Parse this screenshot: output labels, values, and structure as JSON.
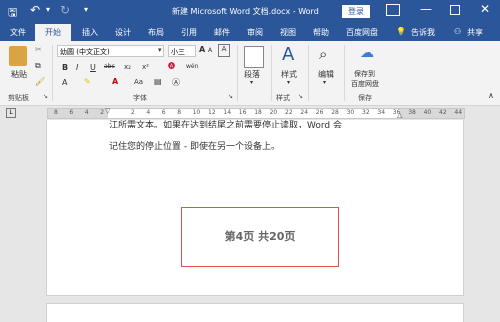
{
  "titlebar": {
    "title": "新建 Microsoft Word 文档.docx  -  Word",
    "login": "登录",
    "save_icon": "save-icon",
    "undo_icon": "undo-icon",
    "redo_icon": "redo-icon",
    "colors": {
      "bg": "#2b579a"
    }
  },
  "tabs": [
    {
      "label": "文件"
    },
    {
      "label": "开始"
    },
    {
      "label": "插入"
    },
    {
      "label": "设计"
    },
    {
      "label": "布局"
    },
    {
      "label": "引用"
    },
    {
      "label": "邮件"
    },
    {
      "label": "审阅"
    },
    {
      "label": "视图"
    },
    {
      "label": "帮助"
    },
    {
      "label": "百度网盘"
    },
    {
      "label": "告诉我"
    },
    {
      "label": "共享"
    }
  ],
  "ribbon": {
    "clipboard": {
      "paste": "粘贴",
      "group": "剪贴板"
    },
    "font": {
      "family": "幼圆 (中文正文)",
      "size": "小三",
      "bold": "B",
      "italic": "I",
      "underline": "U",
      "strike": "abc",
      "sub": "x₂",
      "sup": "x²",
      "grow": "A",
      "shrink": "A",
      "aa": "Aa",
      "wen": "wén",
      "a_box": "A",
      "group": "字体"
    },
    "paragraph": {
      "label": "段落"
    },
    "styles": {
      "label": "样式",
      "group": "样式"
    },
    "editing": {
      "label": "编辑"
    },
    "baidu": {
      "label1": "保存到",
      "label2": "百度网盘",
      "group": "保存"
    }
  },
  "ruler": {
    "ticks": [
      "8",
      "6",
      "4",
      "2",
      "",
      "2",
      "4",
      "6",
      "8",
      "10",
      "12",
      "14",
      "16",
      "18",
      "20",
      "22",
      "24",
      "26",
      "28",
      "30",
      "32",
      "34",
      "36",
      "38",
      "40",
      "42",
      "44"
    ]
  },
  "document": {
    "line1": "江所需文本。如果在达到结尾之前需要停止读取，Word 会",
    "line2": "记住您的停止位置 - 即使在另一个设备上。",
    "page_badge": "第4页  共20页"
  }
}
